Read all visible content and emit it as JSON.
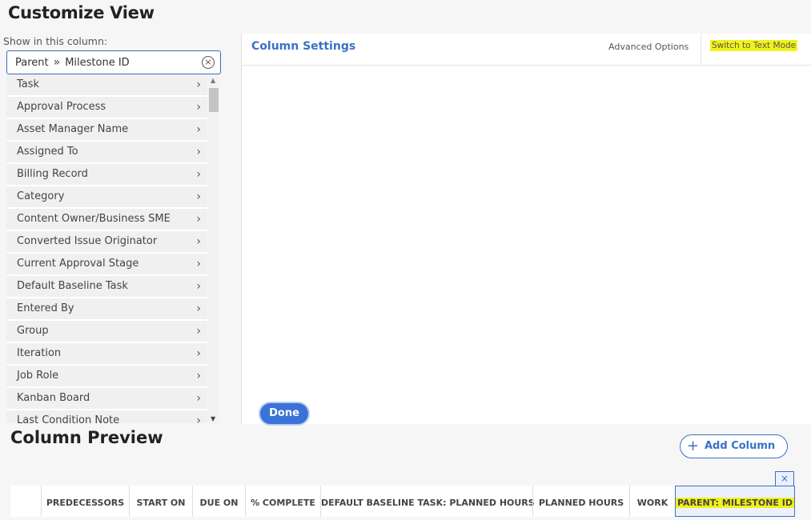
{
  "title": "Customize View",
  "show_label": "Show in this column:",
  "search": {
    "part1": "Parent",
    "separator": "»",
    "part2": "Milestone ID",
    "clear_icon": "×"
  },
  "fields": [
    "Task",
    "Approval Process",
    "Asset Manager Name",
    "Assigned To",
    "Billing Record",
    "Category",
    "Content Owner/Business SME",
    "Converted Issue Originator",
    "Current Approval Stage",
    "Default Baseline Task",
    "Entered By",
    "Group",
    "Iteration",
    "Job Role",
    "Kanban Board",
    "Last Condition Note"
  ],
  "chevron": "›",
  "scroll_up": "▲",
  "scroll_down": "▼",
  "settings": {
    "title": "Column Settings",
    "advanced": "Advanced Options",
    "text_mode": "Switch to Text Mode",
    "highlight_color": "#f2f21a"
  },
  "done_label": "Done",
  "preview": {
    "title": "Column Preview",
    "add_column": "Add Column",
    "add_icon": "+",
    "close_icon": "×",
    "columns": [
      "",
      "PREDECESSORS",
      "START ON",
      "DUE ON",
      "% COMPLETE",
      "DEFAULT BASELINE TASK: PLANNED HOURS",
      "PLANNED HOURS",
      "WORK",
      "PARENT: MILESTONE ID"
    ]
  },
  "accent_color": "#3a72c4"
}
